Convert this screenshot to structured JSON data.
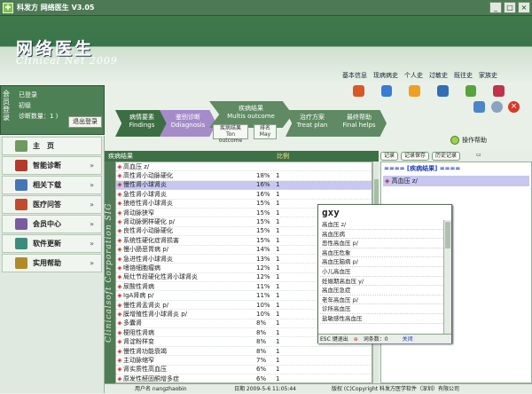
{
  "window": {
    "title": "科发方 网络医生 V3.05",
    "min": "_",
    "max": "□",
    "close": "×"
  },
  "header": {
    "logo_cn": "网络医生",
    "logo_en": "Clinical Net 2009"
  },
  "topmenu": [
    "基本信息",
    "现病病史",
    "个人史",
    "过敏史",
    "既往史",
    "家族史"
  ],
  "topicons": [
    {
      "name": "person-icon",
      "color": "#d9582a"
    },
    {
      "name": "medicine-icon",
      "color": "#3a7bd5"
    },
    {
      "name": "orange-circle-icon",
      "color": "#f0a020"
    },
    {
      "name": "blue-sphere-icon",
      "color": "#2f6fb8"
    },
    {
      "name": "green-book-icon",
      "color": "#5aa33c"
    },
    {
      "name": "gift-icon",
      "color": "#c2324a"
    }
  ],
  "login": {
    "vertical": "会员登录",
    "line1": "已登录",
    "line2": "初级",
    "line3": "诊断数量：1 )",
    "logout": "退出登录"
  },
  "nav": [
    {
      "icon": "house-icon",
      "label": "主　页",
      "color": "#6e9a5e",
      "arrow": ""
    },
    {
      "icon": "stethoscope-icon",
      "label": "智能诊断",
      "color": "#b33a2c",
      "arrow": "»"
    },
    {
      "icon": "download-icon",
      "label": "相关下载",
      "color": "#4676b5",
      "arrow": "»"
    },
    {
      "icon": "question-icon",
      "label": "医疗问答",
      "color": "#c04c2e",
      "arrow": "»"
    },
    {
      "icon": "members-icon",
      "label": "会员中心",
      "color": "#7a5aa0",
      "arrow": "»"
    },
    {
      "icon": "update-icon",
      "label": "软件更新",
      "color": "#3d8b7a",
      "arrow": "»"
    },
    {
      "icon": "help-book-icon",
      "label": "实用帮助",
      "color": "#b08a2a",
      "arrow": "»"
    }
  ],
  "flow": {
    "steps": [
      {
        "l1": "病情要素",
        "l2": "Findings"
      },
      {
        "l1": "鉴别诊断",
        "l2": "Ddiagnosis"
      },
      {
        "l1": "疾病结果",
        "l2": "Multis outcome"
      },
      {
        "l1": "治疗方案",
        "l2": "Treat plan"
      },
      {
        "l1": "最终帮助",
        "l2": "Final helps"
      }
    ],
    "subs": [
      {
        "l1": "疾病结果",
        "l2": "Ton outcome"
      },
      {
        "l1": "排名",
        "l2": "May"
      }
    ]
  },
  "help_button": "操作帮助",
  "results": {
    "header": "疾病结果",
    "pct_header": "比例",
    "rows": [
      {
        "name": "高血压 z/",
        "pct": "",
        "b": ""
      },
      {
        "name": "高性肾小动脉硬化",
        "pct": "18%",
        "b": "1"
      },
      {
        "name": "慢性肾小球肾炎",
        "pct": "16%",
        "b": "1"
      },
      {
        "name": "急性肾小球肾炎",
        "pct": "16%",
        "b": "1"
      },
      {
        "name": "狼疮性肾小球肾炎",
        "pct": "15%",
        "b": "1"
      },
      {
        "name": "肾动脉狭窄",
        "pct": "15%",
        "b": "1"
      },
      {
        "name": "肾动脉粥样硬化 p/",
        "pct": "15%",
        "b": "1"
      },
      {
        "name": "良性肾小动脉硬化",
        "pct": "15%",
        "b": "1"
      },
      {
        "name": "系统性硬化症肾损害",
        "pct": "15%",
        "b": "1"
      },
      {
        "name": "慢小肠恶胃病 p/",
        "pct": "14%",
        "b": "1"
      },
      {
        "name": "急进性肾小球肾炎",
        "pct": "13%",
        "b": "1"
      },
      {
        "name": "嗜铬细胞瘤病",
        "pct": "12%",
        "b": "1"
      },
      {
        "name": "局灶节段硬化性肾小球肾炎",
        "pct": "12%",
        "b": "1"
      },
      {
        "name": "尿酸性肾病",
        "pct": "11%",
        "b": "1"
      },
      {
        "name": "IgA肾病 p/",
        "pct": "11%",
        "b": "1"
      },
      {
        "name": "慢性肾盂肾炎 p/",
        "pct": "10%",
        "b": "1"
      },
      {
        "name": "膜增殖性肾小球肾炎 p/",
        "pct": "10%",
        "b": "1"
      },
      {
        "name": "多囊肾",
        "pct": "8%",
        "b": "1"
      },
      {
        "name": "梗阻性肾病",
        "pct": "8%",
        "b": "1"
      },
      {
        "name": "肾淀粉样变",
        "pct": "8%",
        "b": "1"
      },
      {
        "name": "慢性肾功能衰竭",
        "pct": "8%",
        "b": "1"
      },
      {
        "name": "主动脉缩窄",
        "pct": "7%",
        "b": "1"
      },
      {
        "name": "肾实质性高血压",
        "pct": "6%",
        "b": "1"
      },
      {
        "name": "原发性醛固酮增多症",
        "pct": "6%",
        "b": "1"
      }
    ],
    "selected": 2,
    "side_text": "Clinicalsoft Corporation SIG"
  },
  "tabs": [
    "记录",
    "记录保存",
    "历史记录"
  ],
  "record": {
    "head": "==== [疾病结果] ====",
    "item": "高血压 z/"
  },
  "popup": {
    "title": "gxy",
    "items": [
      "高血压 z/",
      "高血压病",
      "恶性高血压 p/",
      "高血压危象",
      "高血压脑病 p/",
      "小儿高血压",
      "妊娠期高血压 y/",
      "高血压急症",
      "老年高血压 p/",
      "诊所高血压",
      "盐敏感性高血压"
    ],
    "footer_esc": "ESC 键退出",
    "footer_count": "词条数：0",
    "footer_close": "关闭"
  },
  "status": {
    "user": "用户名 nangzhaobin",
    "date": "日期 2009-5-6 11:05:44",
    "copy": "版权 (C)Copyright 科发方医学软件（深圳）有限公司"
  }
}
